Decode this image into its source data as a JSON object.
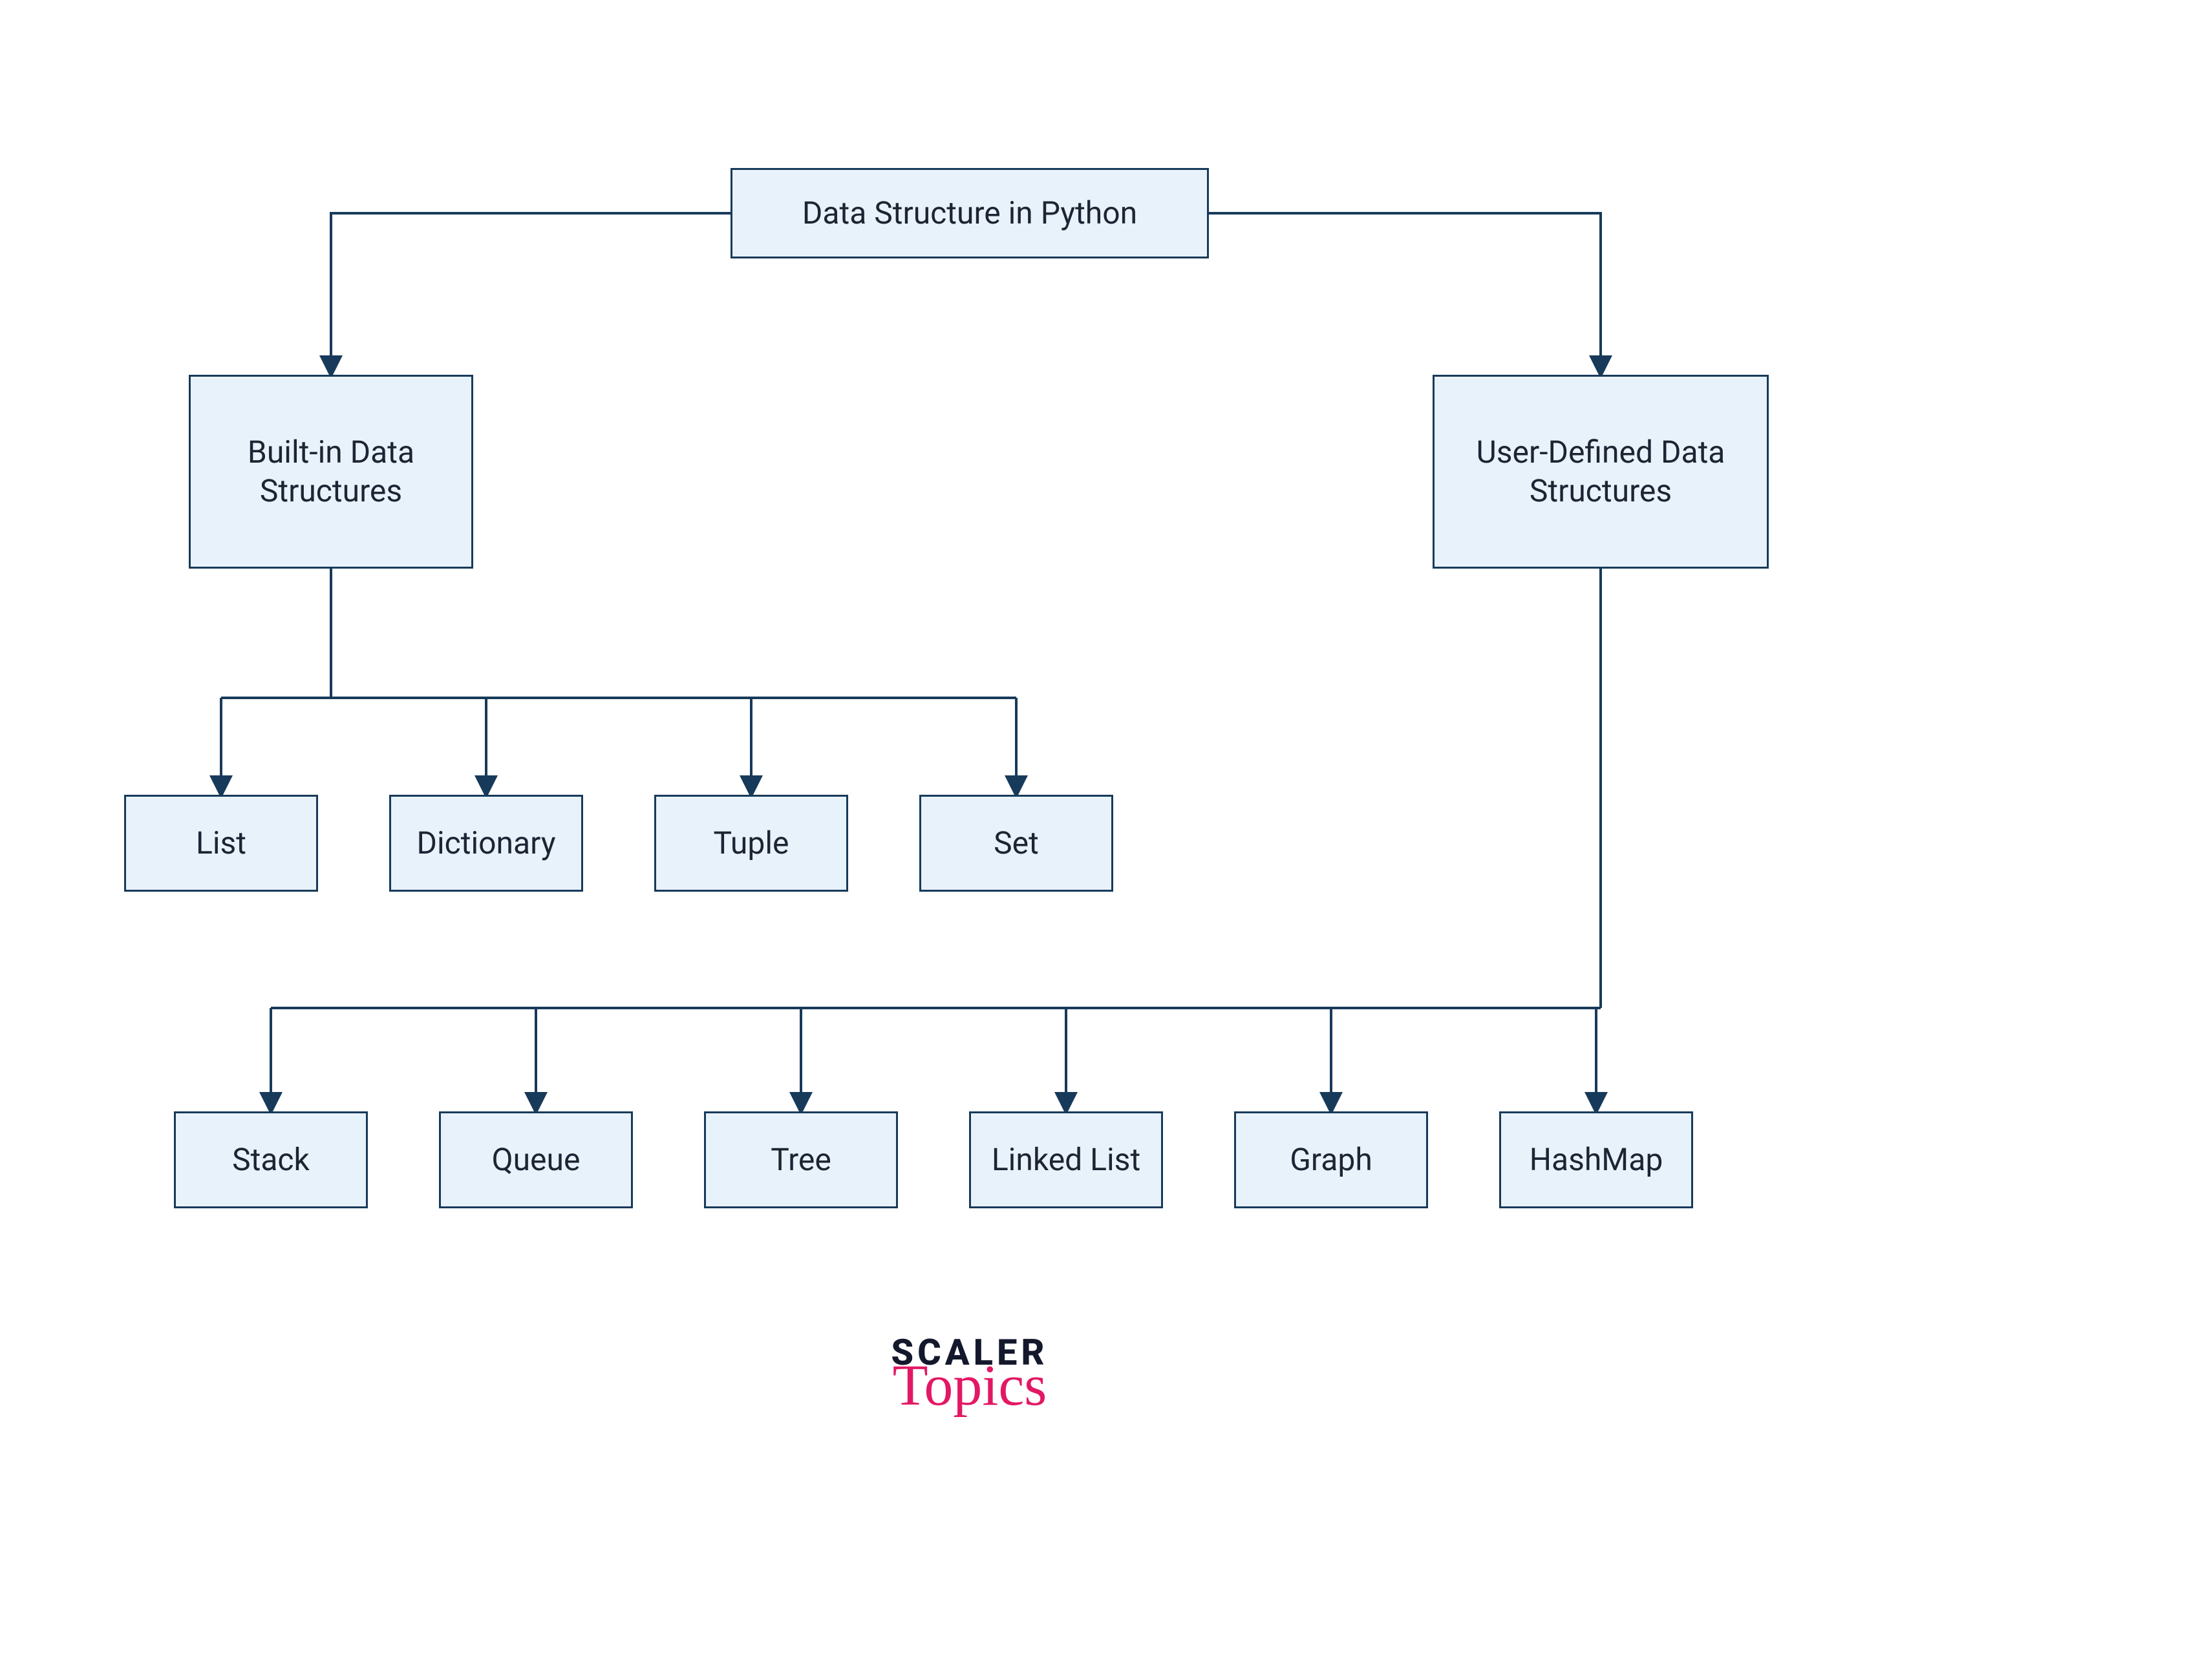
{
  "diagram": {
    "root": {
      "label": "Data Structure in Python"
    },
    "builtin": {
      "label": "Built-in Data\nStructures"
    },
    "userdef": {
      "label": "User-Defined Data\nStructures"
    },
    "list": {
      "label": "List"
    },
    "dict": {
      "label": "Dictionary"
    },
    "tuple": {
      "label": "Tuple"
    },
    "set": {
      "label": "Set"
    },
    "stack": {
      "label": "Stack"
    },
    "queue": {
      "label": "Queue"
    },
    "tree": {
      "label": "Tree"
    },
    "linked": {
      "label": "Linked List"
    },
    "graph": {
      "label": "Graph"
    },
    "hashmap": {
      "label": "HashMap"
    }
  },
  "logo": {
    "line1": "SCALER",
    "line2": "Topics"
  },
  "colors": {
    "node_fill": "#e8f2fb",
    "node_border": "#183a5a",
    "connector": "#183a5a",
    "logo_dark": "#14182c",
    "logo_accent": "#e31864"
  }
}
